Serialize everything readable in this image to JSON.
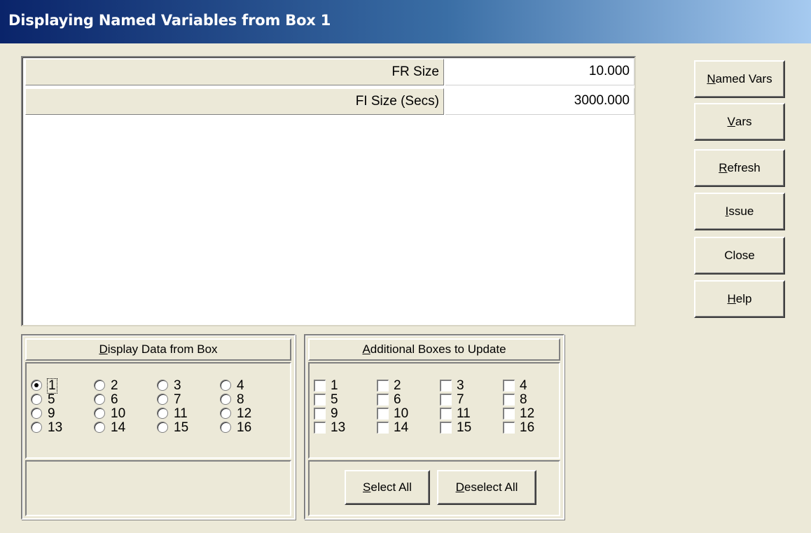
{
  "window": {
    "title": "Displaying Named Variables from Box 1"
  },
  "grid": {
    "rows": [
      {
        "label": "FR Size",
        "value": "10.000"
      },
      {
        "label": "FI Size (Secs)",
        "value": "3000.000"
      }
    ]
  },
  "buttons": {
    "named_vars": {
      "mnemonic": "N",
      "rest": "amed Vars"
    },
    "vars": {
      "mnemonic": "V",
      "rest": "ars"
    },
    "refresh": {
      "mnemonic": "R",
      "rest": "efresh"
    },
    "issue": {
      "mnemonic": "I",
      "rest": "ssue"
    },
    "close": {
      "label": "Close"
    },
    "help": {
      "mnemonic": "H",
      "rest": "elp"
    }
  },
  "display_box": {
    "heading_mnemonic": "D",
    "heading_rest": "isplay Data from Box",
    "selected": "1",
    "options": [
      "1",
      "2",
      "3",
      "4",
      "5",
      "6",
      "7",
      "8",
      "9",
      "10",
      "11",
      "12",
      "13",
      "14",
      "15",
      "16"
    ]
  },
  "additional_boxes": {
    "heading_mnemonic": "A",
    "heading_rest": "dditional Boxes to Update",
    "options": [
      "1",
      "2",
      "3",
      "4",
      "5",
      "6",
      "7",
      "8",
      "9",
      "10",
      "11",
      "12",
      "13",
      "14",
      "15",
      "16"
    ],
    "checked": [],
    "select_all": {
      "mnemonic": "S",
      "rest": "elect All"
    },
    "deselect_all": {
      "mnemonic": "D",
      "rest": "eselect All"
    }
  }
}
